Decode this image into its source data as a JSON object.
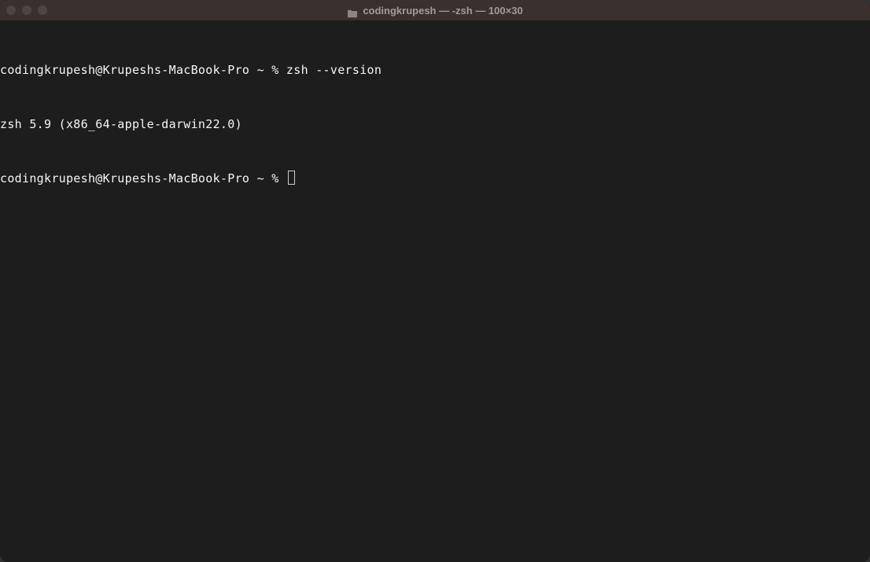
{
  "window": {
    "title": "codingkrupesh — -zsh — 100×30"
  },
  "terminal": {
    "lines": [
      {
        "prompt": "codingkrupesh@Krupeshs-MacBook-Pro ~ % ",
        "command": "zsh --version"
      },
      {
        "output": "zsh 5.9 (x86_64-apple-darwin22.0)"
      },
      {
        "prompt": "codingkrupesh@Krupeshs-MacBook-Pro ~ % ",
        "cursor": true
      }
    ]
  }
}
